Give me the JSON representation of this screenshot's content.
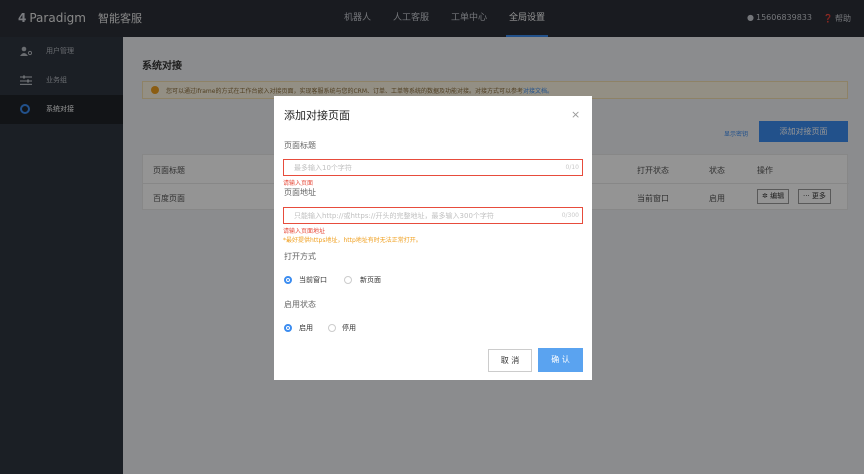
{
  "header": {
    "logo_mark": "4",
    "logo_brand": "Paradigm",
    "product": "智能客服",
    "nav": [
      {
        "label": "机器人",
        "active": false
      },
      {
        "label": "人工客服",
        "active": false
      },
      {
        "label": "工单中心",
        "active": false
      },
      {
        "label": "全局设置",
        "active": true
      }
    ],
    "user": "15606839833",
    "help": "帮助"
  },
  "sidebar": {
    "items": [
      {
        "label": "用户管理",
        "icon": "user-gear-icon",
        "active": false
      },
      {
        "label": "业务组",
        "icon": "sliders-icon",
        "active": false
      },
      {
        "label": "系统对接",
        "icon": "circle-icon",
        "active": true
      }
    ]
  },
  "page": {
    "title": "系统对接",
    "notice_text": "您可以通过iframe的方式在工作台嵌入对接页面，实现客服系统与您的CRM、订单、工单等系统的数据及功能对接。对接方式可以参考",
    "notice_link": "对接文档。",
    "show_config": "显示密钥",
    "add_button": "添加对接页面"
  },
  "table": {
    "headers": {
      "title": "页面标题",
      "open_mode": "打开状态",
      "status": "状态",
      "actions": "操作"
    },
    "rows": [
      {
        "title": "百度页面",
        "open_mode": "当前窗口",
        "status": "启用",
        "edit": "✲ 编辑",
        "more": "··· 更多"
      }
    ]
  },
  "modal": {
    "title": "添加对接页面",
    "close": "×",
    "title_field": {
      "label": "页面标题",
      "value": "",
      "placeholder": "最多输入10个字符",
      "counter": "0/10",
      "error": "请输入页面"
    },
    "url_field": {
      "label": "页面地址",
      "value": "",
      "placeholder": "只能输入http://或https://开头的完整地址，最多输入300个字符",
      "counter": "0/300",
      "error": "请输入页面地址",
      "warning": "*最好提供https地址，http地址有时无法正常打开。"
    },
    "open_mode": {
      "label": "打开方式",
      "options": [
        {
          "label": "当前窗口",
          "selected": true
        },
        {
          "label": "新页面",
          "selected": false
        }
      ]
    },
    "status": {
      "label": "启用状态",
      "options": [
        {
          "label": "启用",
          "selected": true
        },
        {
          "label": "停用",
          "selected": false
        }
      ]
    },
    "cancel": "取 消",
    "confirm": "确 认"
  },
  "colors": {
    "topbar": "#2b2f38",
    "sidebar": "#303641",
    "accent": "#3b8cf0",
    "error": "#e74c3c",
    "warning": "#f0a020"
  }
}
